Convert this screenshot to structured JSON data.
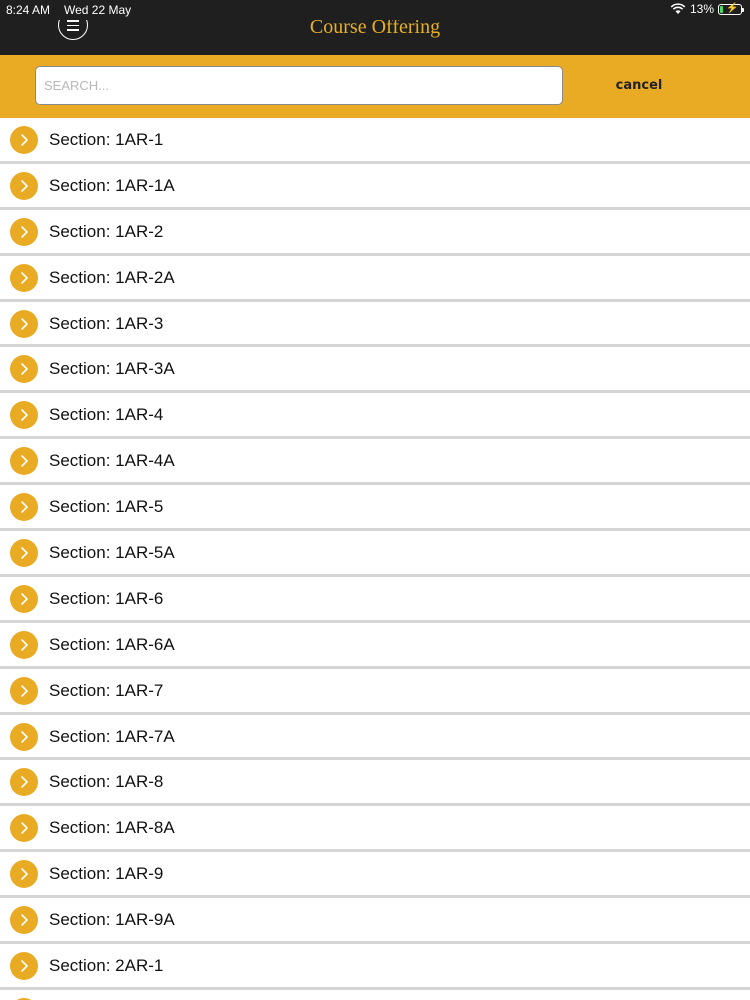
{
  "status_bar": {
    "time": "8:24 AM",
    "date": "Wed 22 May",
    "battery_percent": "13%",
    "battery_level": 0.13
  },
  "nav": {
    "title": "Course Offering",
    "menu_icon": "hamburger-menu-icon",
    "title_color": "#e8b023",
    "bar_color": "#1f1f1f"
  },
  "search": {
    "placeholder": "SEARCH...",
    "value": "",
    "cancel_label": "cancel",
    "accent_color": "#e9ab24"
  },
  "sections": [
    {
      "label": "Section: 1AR-1"
    },
    {
      "label": "Section: 1AR-1A"
    },
    {
      "label": "Section: 1AR-2"
    },
    {
      "label": "Section: 1AR-2A"
    },
    {
      "label": "Section: 1AR-3"
    },
    {
      "label": "Section: 1AR-3A"
    },
    {
      "label": "Section: 1AR-4"
    },
    {
      "label": "Section: 1AR-4A"
    },
    {
      "label": "Section: 1AR-5"
    },
    {
      "label": "Section: 1AR-5A"
    },
    {
      "label": "Section: 1AR-6"
    },
    {
      "label": "Section: 1AR-6A"
    },
    {
      "label": "Section: 1AR-7"
    },
    {
      "label": "Section: 1AR-7A"
    },
    {
      "label": "Section: 1AR-8"
    },
    {
      "label": "Section: 1AR-8A"
    },
    {
      "label": "Section: 1AR-9"
    },
    {
      "label": "Section: 1AR-9A"
    },
    {
      "label": "Section: 2AR-1"
    },
    {
      "label": ""
    }
  ]
}
